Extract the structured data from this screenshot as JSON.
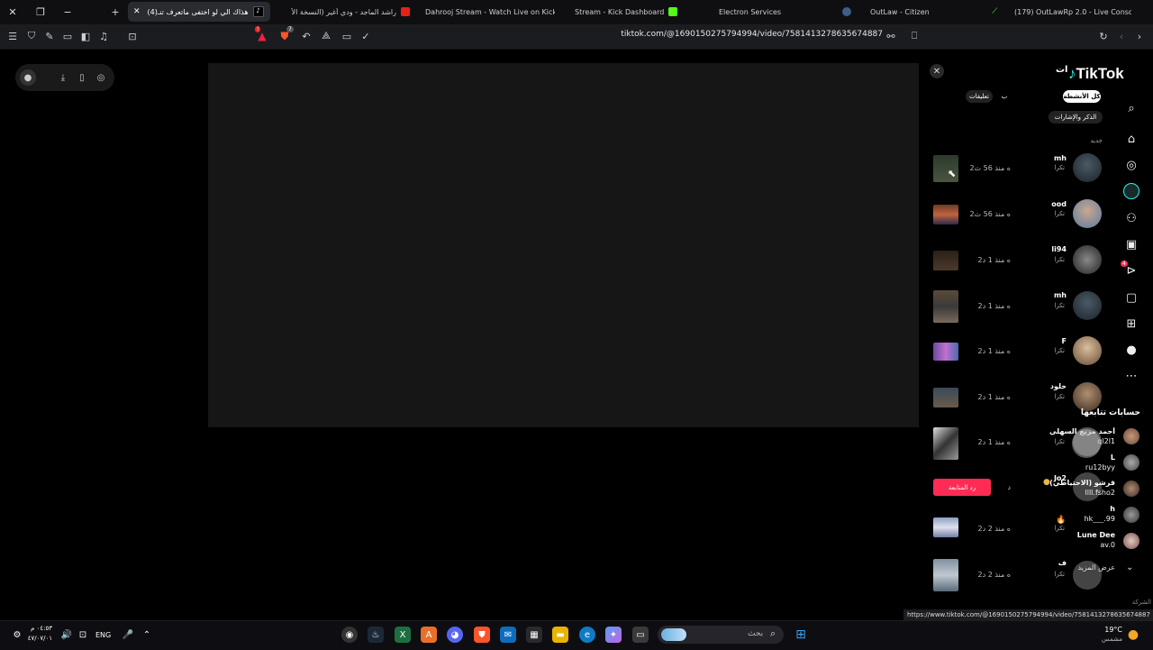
{
  "browser": {
    "tabs": [
      {
        "title": "(4)هذاك الي لو اختفى ماتعرف تنـ",
        "active": true
      },
      {
        "title": "راشد الماجد - ودي أغير (النسخة الأ",
        "active": false
      },
      {
        "title": "Dahrooj Stream - Watch Live on Kick",
        "active": false
      },
      {
        "title": "Stream - Kick Dashboard",
        "active": false
      },
      {
        "title": "Electron Services",
        "active": false
      },
      {
        "title": "OutLaw - Citizen",
        "active": false
      },
      {
        "title": "(179) OutLawRp 2.0 - Live Console",
        "active": false
      }
    ],
    "url": "tiktok.com/@1690150275794994/video/7581413278635674887",
    "status_url": "https://www.tiktok.com/@1690150275794994/video/7581413278635674887",
    "badges": {
      "brave_shield": "7",
      "alert": "!"
    }
  },
  "tiktok": {
    "logo": "TikTok",
    "header_partial": "ات",
    "filters": {
      "all": "كل الأنشطة",
      "comments": "تعليقات",
      "partial": "ب",
      "mentions": "الذكر والإشارات"
    },
    "section_new": "جديد",
    "notifications": [
      {
        "name": "mh",
        "sub": "تكرا",
        "time": "2ه منذ 56 ث"
      },
      {
        "name": "ood",
        "sub": "تكرا",
        "time": "2ه منذ 56 ث"
      },
      {
        "name": "li94",
        "sub": "تكرا",
        "time": "2ه منذ 1 د"
      },
      {
        "name": "mh",
        "sub": "تكرا",
        "time": "2ه منذ 1 د"
      },
      {
        "name": "F",
        "sub": "تكرا",
        "time": "2ه منذ 1 د"
      },
      {
        "name": "خلود",
        "sub": "تكرا",
        "time": "2ه منذ 1 د"
      },
      {
        "name": "",
        "sub": "تكرا",
        "time": "2ه منذ 1 د"
      },
      {
        "name": "Jo2",
        "sub": "",
        "time": "د"
      },
      {
        "name": "",
        "sub": "تكرا",
        "time": "2ه منذ 2 د"
      },
      {
        "name": "ف",
        "sub": "تكرا",
        "time": "2ه منذ 2 د"
      }
    ],
    "follow_back_button": "رد المتابعة",
    "following_title": "حسابات تتابعها",
    "following": [
      {
        "name": "أحمد مزيع السهلي",
        "handle": "ql2l1"
      },
      {
        "name": "L",
        "handle": "ru12byy"
      },
      {
        "name": "قرشو (الاحتياطي)",
        "handle": "llll.fsho2"
      },
      {
        "name": "h",
        "handle": "hk___.99"
      },
      {
        "name": "Lune Dee",
        "handle": "av.0"
      }
    ],
    "see_more": "عرض المزيد",
    "company_partial": "الشركة",
    "inbox_badge": "4"
  },
  "taskbar": {
    "time": "٠٤:٥٣ م",
    "date": "٤٧/٠٧/٠١",
    "lang": "ENG",
    "search_placeholder": "بحث",
    "weather_temp": "19°C",
    "weather_desc": "مشمس"
  }
}
